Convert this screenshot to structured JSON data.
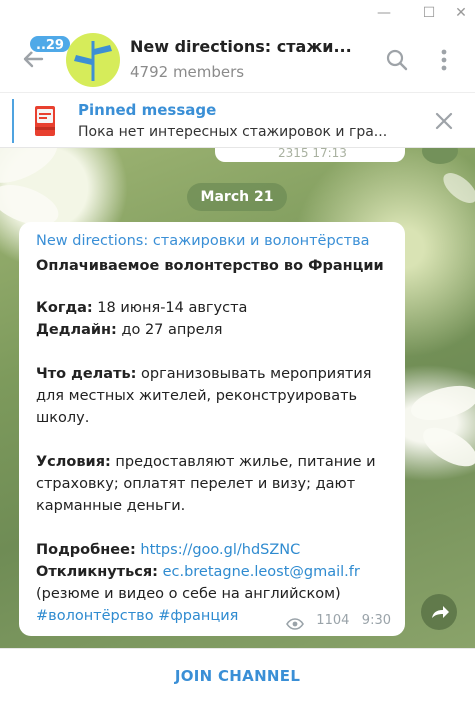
{
  "window": {
    "minimize": "—",
    "maximize": "☐",
    "close": "✕"
  },
  "header": {
    "unread_badge": "..29",
    "title": "New directions: стажи...",
    "subtitle": "4792 members",
    "icons": [
      "back-arrow-icon",
      "search-icon",
      "more-vertical-icon"
    ]
  },
  "pinned": {
    "title": "Pinned message",
    "text": "Пока нет интересных стажировок и гра...",
    "icon": "notebook-icon"
  },
  "previous_message": {
    "meta": "2315   17:13"
  },
  "date_pill": "March 21",
  "message": {
    "channel": "New directions: стажировки и волонтёрства",
    "headline": "Оплачиваемое волонтерство во Франции",
    "when_label": "Когда:",
    "when_value": " 18 июня-14 августа",
    "deadline_label": "Дедлайн:",
    "deadline_value": " до 27 апреля",
    "todo_label": "Что делать:",
    "todo_line1": " организовывать мероприятия",
    "todo_line2": "для местных жителей, реконструировать",
    "todo_line3": "школу.",
    "cond_label": "Условия:",
    "cond_line1": " предоставляют жилье, питание и",
    "cond_line2": "страховку; оплатят перелет и визу; дают",
    "cond_line3": "карманные деньги.",
    "more_label": "Подробнее:",
    "more_link": "https://goo.gl/hdSZNC",
    "apply_label": "Откликнуться:",
    "apply_email": "ec.bretagne.leost@gmail.fr",
    "apply_note": "(резюме и видео о себе на английском)",
    "hashtags": "#волонтёрство #франция",
    "views": "1104",
    "time": "9:30"
  },
  "footer": {
    "join_label": "JOIN CHANNEL"
  },
  "colors": {
    "accent": "#3a8fd6",
    "badge": "#4fa9e8",
    "avatar": "#d6ec5a"
  }
}
